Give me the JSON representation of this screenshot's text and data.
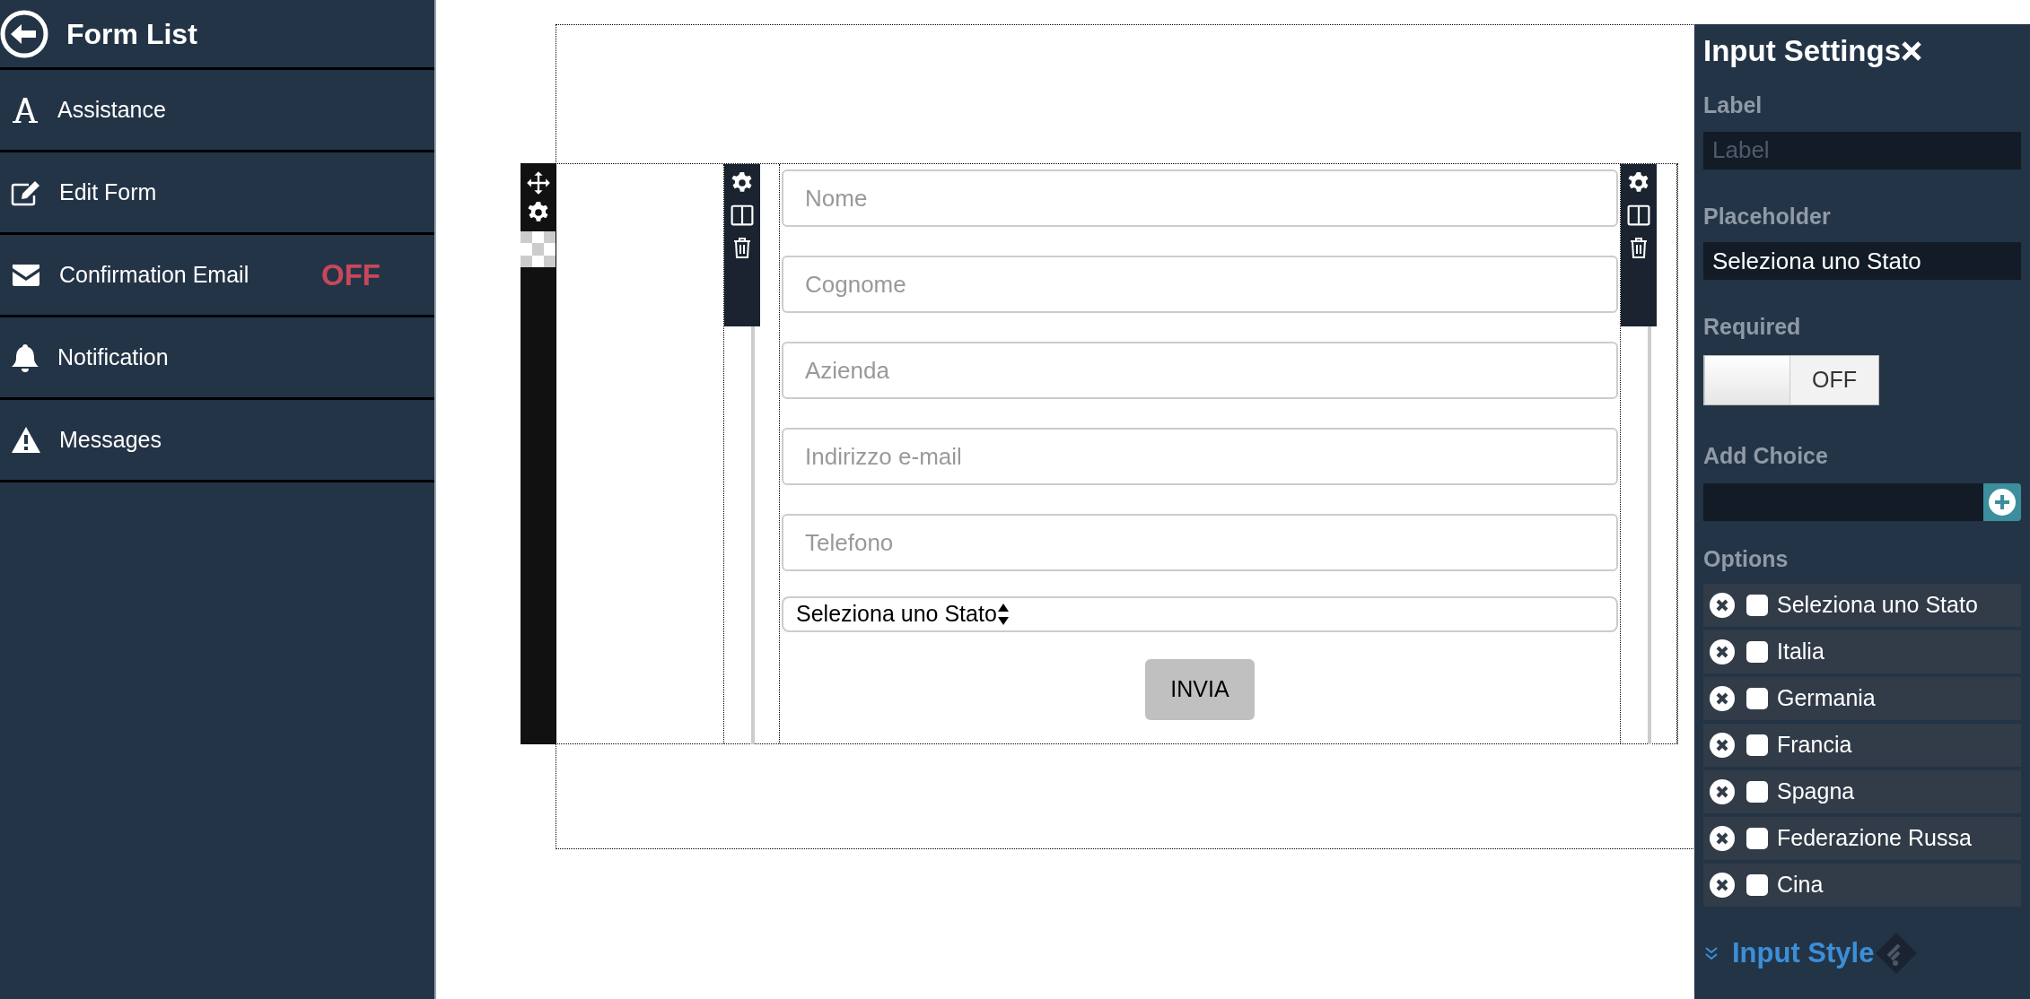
{
  "sidebar": {
    "title": "Form List",
    "items": [
      {
        "label": "Assistance"
      },
      {
        "label": "Edit Form"
      },
      {
        "label": "Confirmation Email",
        "badge": "OFF"
      },
      {
        "label": "Notification"
      },
      {
        "label": "Messages"
      }
    ]
  },
  "form": {
    "fields": [
      {
        "kind": "text",
        "placeholder": "Nome"
      },
      {
        "kind": "text",
        "placeholder": "Cognome"
      },
      {
        "kind": "text",
        "placeholder": "Azienda"
      },
      {
        "kind": "text",
        "placeholder": "Indirizzo e-mail"
      },
      {
        "kind": "text",
        "placeholder": "Telefono"
      },
      {
        "kind": "select",
        "value": "Seleziona uno Stato"
      }
    ],
    "submit": "INVIA"
  },
  "settings": {
    "title": "Input Settings",
    "label_field": {
      "label": "Label",
      "placeholder": "Label"
    },
    "placeholder_field": {
      "label": "Placeholder",
      "value": "Seleziona uno Stato"
    },
    "required": {
      "label": "Required",
      "on": false,
      "text": "OFF"
    },
    "add_choice": {
      "label": "Add Choice"
    },
    "options_label": "Options",
    "options": [
      {
        "label": "Seleziona uno Stato",
        "checked": false
      },
      {
        "label": "Italia",
        "checked": false
      },
      {
        "label": "Germania",
        "checked": false
      },
      {
        "label": "Francia",
        "checked": false
      },
      {
        "label": "Spagna",
        "checked": false
      },
      {
        "label": "Federazione Russa",
        "checked": false
      },
      {
        "label": "Cina",
        "checked": false
      }
    ],
    "input_style": "Input Style"
  }
}
